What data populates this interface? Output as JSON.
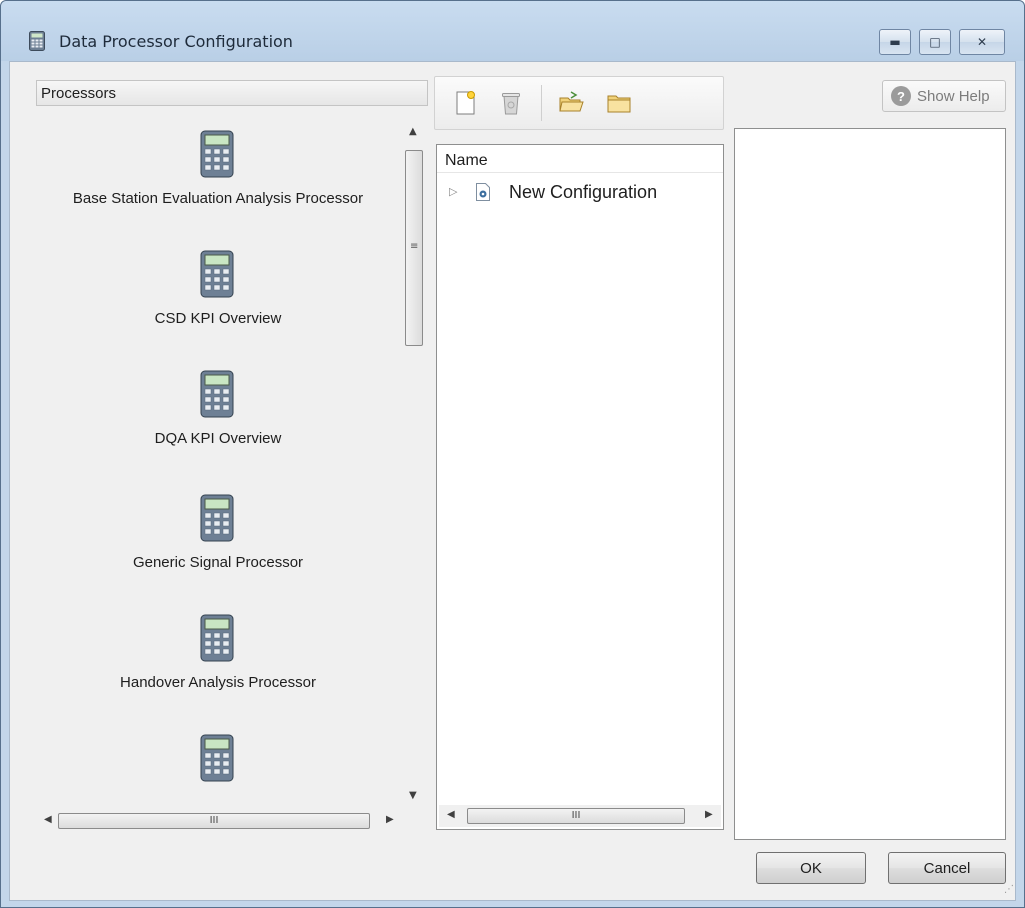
{
  "window": {
    "title": "Data Processor Configuration"
  },
  "processors": {
    "header": "Processors",
    "items": [
      {
        "label": "Base Station Evaluation Analysis Processor",
        "icon": "calculator-icon"
      },
      {
        "label": "CSD KPI Overview",
        "icon": "calculator-icon"
      },
      {
        "label": "DQA KPI Overview",
        "icon": "calculator-icon"
      },
      {
        "label": "Generic Signal Processor",
        "icon": "calculator-icon"
      },
      {
        "label": "Handover Analysis Processor",
        "icon": "calculator-icon"
      },
      {
        "label": "",
        "icon": "calculator-icon"
      }
    ],
    "hscroll_thumb": "III"
  },
  "toolbar": {
    "new_icon": "new-document-icon",
    "delete_icon": "recycle-bin-icon",
    "open_icon": "open-folder-icon",
    "save_icon": "folder-icon"
  },
  "tree": {
    "header": "Name",
    "rows": [
      {
        "label": "New Configuration",
        "icon": "config-document-icon"
      }
    ],
    "hscroll_thumb": "III"
  },
  "help": {
    "label": "Show Help"
  },
  "buttons": {
    "ok": "OK",
    "cancel": "Cancel"
  },
  "colors": {
    "title_bar": "#c3d6ea",
    "client_bg": "#f0f0f0"
  }
}
